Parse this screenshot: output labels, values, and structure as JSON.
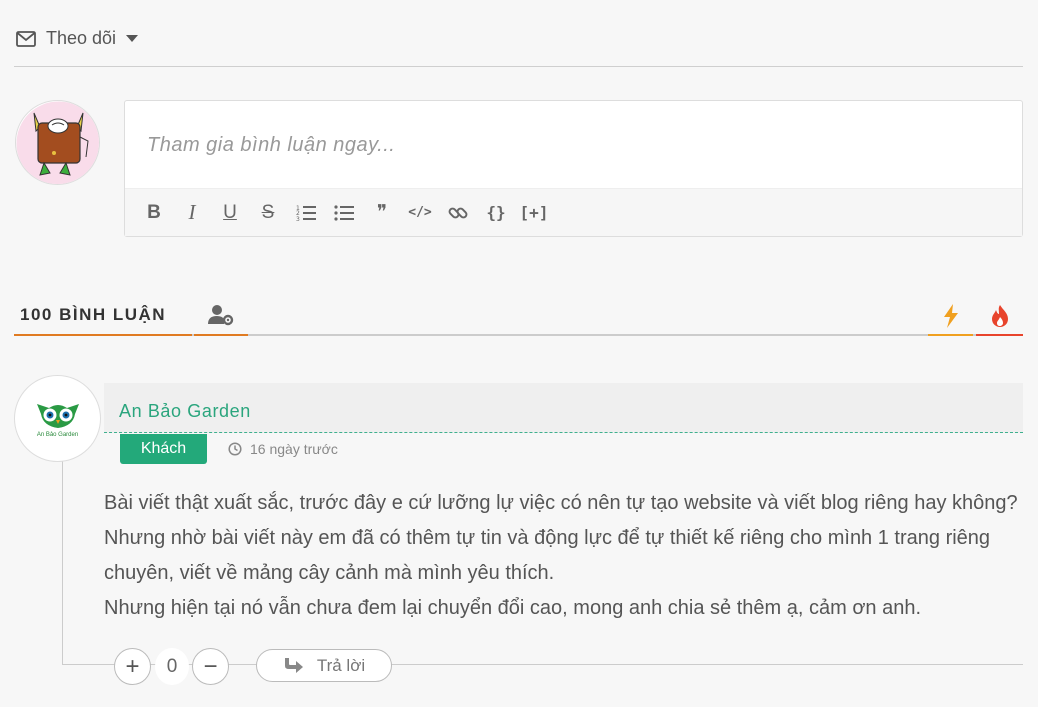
{
  "follow": {
    "label": "Theo dõi",
    "icon": "envelope-icon"
  },
  "editor": {
    "placeholder": "Tham gia bình luận ngay...",
    "toolbar": {
      "bold": "B",
      "italic": "I",
      "underline": "U",
      "strike": "S",
      "blockquote": "❞",
      "code_inline": "</>",
      "code_block": "{}",
      "spoiler": "[+]"
    }
  },
  "tabs": {
    "count_label": "100 BÌNH LUẬN",
    "colors": {
      "accent": "#e07b22",
      "bolt": "#f0a020",
      "fire": "#e8442c"
    }
  },
  "comment": {
    "author": "An Bảo Garden",
    "avatar_text": "An Bảo Garden",
    "badge": "Khách",
    "time": "16 ngày trước",
    "body_lines": [
      "Bài viết thật xuất sắc, trước đây e cứ lưỡng lự việc có nên tự tạo website và viết blog riêng hay không? Nhưng nhờ bài viết này em đã có thêm tự tin và động lực để tự thiết kế riêng cho mình 1 trang riêng chuyên, viết về mảng cây cảnh mà mình yêu thích.",
      "Nhưng hiện tại nó vẫn chưa đem lại chuyển đổi cao, mong anh chia sẻ thêm ạ, cảm ơn anh."
    ],
    "votes": {
      "up": "+",
      "count": "0",
      "down": "−"
    },
    "reply_label": "Trả lời",
    "colors": {
      "author": "#2aa57d",
      "badge_bg": "#23a97a"
    }
  }
}
